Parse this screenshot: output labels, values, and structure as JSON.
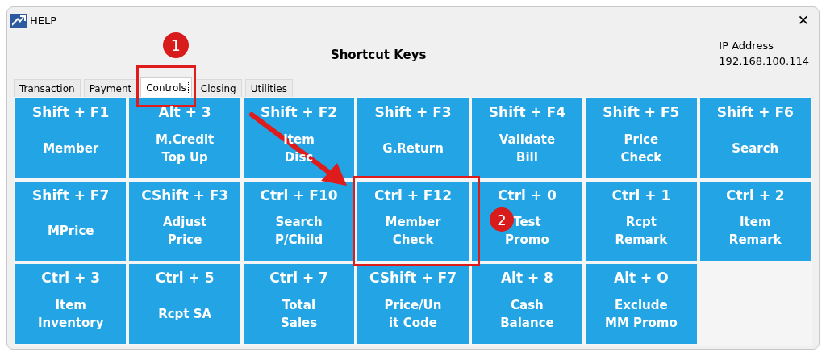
{
  "window": {
    "title": "HELP",
    "close": "✕"
  },
  "header": {
    "title": "Shortcut Keys",
    "ip_label": "IP Address",
    "ip_value": "192.168.100.114"
  },
  "tabs": [
    {
      "label": "Transaction",
      "selected": false
    },
    {
      "label": "Payment",
      "selected": false
    },
    {
      "label": "Controls",
      "selected": true
    },
    {
      "label": "Closing",
      "selected": false
    },
    {
      "label": "Utilities",
      "selected": false
    }
  ],
  "shortcuts": [
    {
      "key": "Shift + F1",
      "label": [
        "Member"
      ]
    },
    {
      "key": "Alt + 3",
      "label": [
        "M.Credit",
        "Top Up"
      ]
    },
    {
      "key": "Shift + F2",
      "label": [
        "Item",
        "Disc"
      ]
    },
    {
      "key": "Shift + F3",
      "label": [
        "G.Return"
      ]
    },
    {
      "key": "Shift + F4",
      "label": [
        "Validate",
        "Bill"
      ]
    },
    {
      "key": "Shift + F5",
      "label": [
        "Price",
        "Check"
      ]
    },
    {
      "key": "Shift + F6",
      "label": [
        "Search"
      ]
    },
    {
      "key": "Shift + F7",
      "label": [
        "MPrice"
      ]
    },
    {
      "key": "CShift + F3",
      "label": [
        "Adjust",
        "Price"
      ]
    },
    {
      "key": "Ctrl + F10",
      "label": [
        "Search",
        "P/Child"
      ]
    },
    {
      "key": "Ctrl + F12",
      "label": [
        "Member",
        "Check"
      ]
    },
    {
      "key": "Ctrl + 0",
      "label": [
        "Test",
        "Promo"
      ]
    },
    {
      "key": "Ctrl + 1",
      "label": [
        "Rcpt",
        "Remark"
      ]
    },
    {
      "key": "Ctrl + 2",
      "label": [
        "Item",
        "Remark"
      ]
    },
    {
      "key": "Ctrl + 3",
      "label": [
        "Item",
        "Inventory"
      ]
    },
    {
      "key": "Ctrl + 5",
      "label": [
        "Rcpt SA"
      ]
    },
    {
      "key": "Ctrl + 7",
      "label": [
        "Total",
        "Sales"
      ]
    },
    {
      "key": "CShift + F7",
      "label": [
        "Price/Un",
        "it Code"
      ]
    },
    {
      "key": "Alt + 8",
      "label": [
        "Cash",
        "Balance"
      ]
    },
    {
      "key": "Alt + O",
      "label": [
        "Exclude",
        "MM Promo"
      ]
    }
  ],
  "annotations": [
    {
      "label": "1"
    },
    {
      "label": "2"
    }
  ]
}
